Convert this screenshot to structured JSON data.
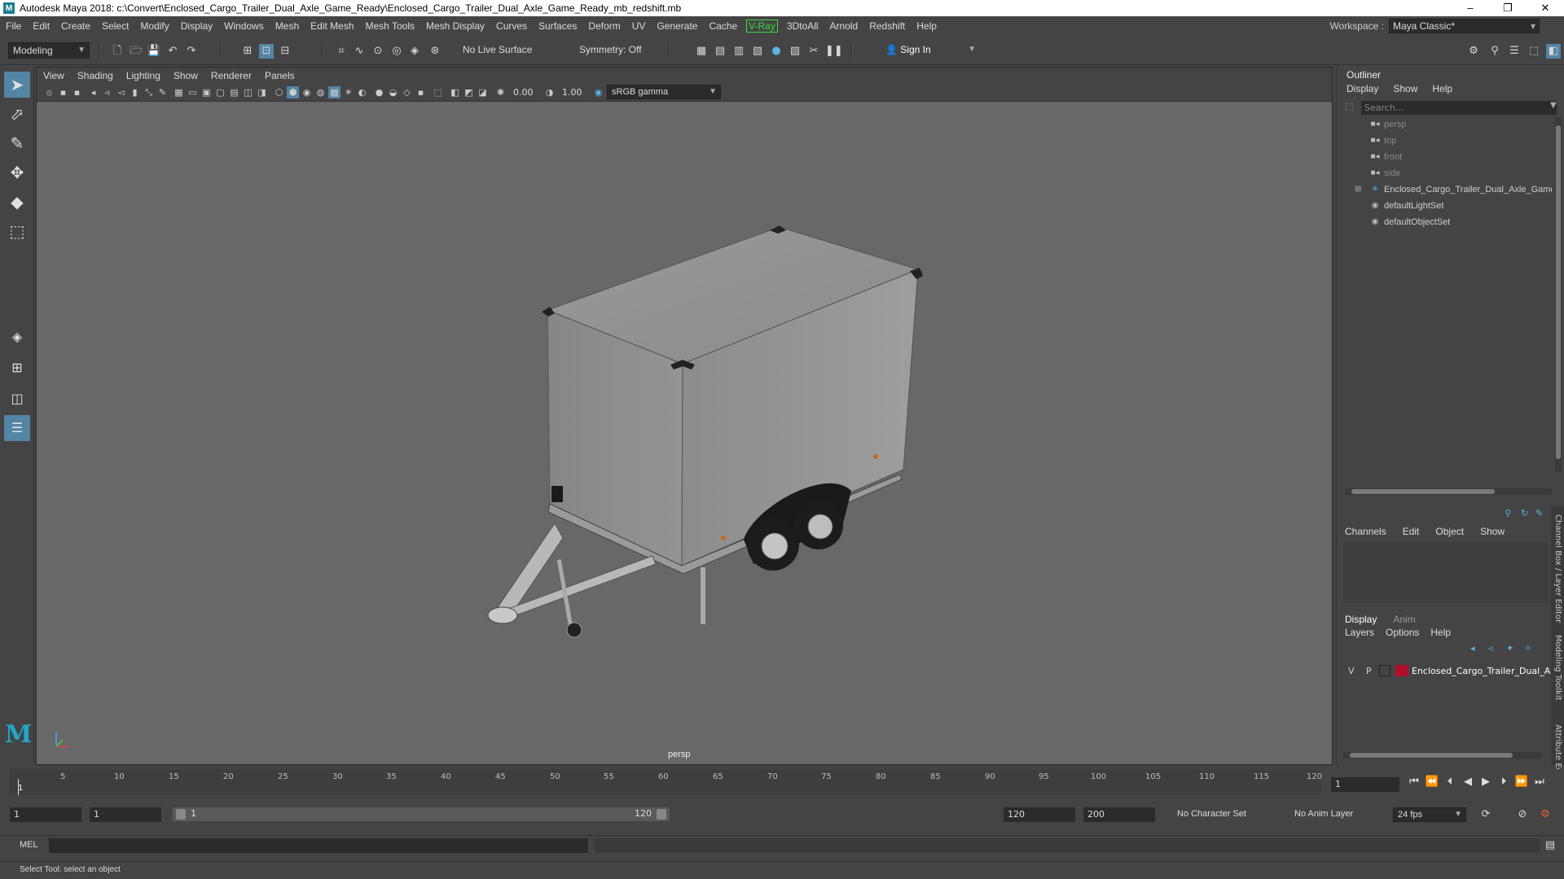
{
  "titlebar": {
    "title": "Autodesk Maya 2018: c:\\Convert\\Enclosed_Cargo_Trailer_Dual_Axle_Game_Ready\\Enclosed_Cargo_Trailer_Dual_Axle_Game_Ready_mb_redshift.mb",
    "logo": "M",
    "minimize": "–",
    "maximize": "❐",
    "close": "✕"
  },
  "menubar": {
    "items": [
      "File",
      "Edit",
      "Create",
      "Select",
      "Modify",
      "Display",
      "Windows",
      "Mesh",
      "Edit Mesh",
      "Mesh Tools",
      "Mesh Display",
      "Curves",
      "Surfaces",
      "Deform",
      "UV",
      "Generate",
      "Cache",
      "V-Ray",
      "3DtoAll",
      "Arnold",
      "Redshift",
      "Help"
    ],
    "workspace_label": "Workspace :",
    "workspace_value": "Maya Classic*"
  },
  "statusline": {
    "mode": "Modeling",
    "live_surface": "No Live Surface",
    "symmetry": "Symmetry: Off",
    "sign_in": "Sign In"
  },
  "toolbox": {
    "tools": [
      "select-tool",
      "lasso-tool",
      "paint-select-tool",
      "move-tool",
      "rotate-tool",
      "scale-tool"
    ]
  },
  "viewport": {
    "menu": [
      "View",
      "Shading",
      "Lighting",
      "Show",
      "Renderer",
      "Panels"
    ],
    "exposure": "0.00",
    "gamma": "1.00",
    "color_space": "sRGB gamma",
    "camera_label": "persp"
  },
  "outliner": {
    "title": "Outliner",
    "menu": [
      "Display",
      "Show",
      "Help"
    ],
    "search_placeholder": "Search...",
    "items": [
      {
        "label": "persp",
        "icon": "camera-icon",
        "dim": true
      },
      {
        "label": "top",
        "icon": "camera-icon",
        "dim": true
      },
      {
        "label": "front",
        "icon": "camera-icon",
        "dim": true
      },
      {
        "label": "side",
        "icon": "camera-icon",
        "dim": true
      },
      {
        "label": "Enclosed_Cargo_Trailer_Dual_Axle_Game",
        "icon": "group-icon",
        "dim": false
      },
      {
        "label": "defaultLightSet",
        "icon": "set-icon",
        "dim": false
      },
      {
        "label": "defaultObjectSet",
        "icon": "set-icon",
        "dim": false
      }
    ]
  },
  "channelbox": {
    "tabs": [
      "Channels",
      "Edit",
      "Object",
      "Show"
    ],
    "layer_tabs": [
      "Display",
      "Anim"
    ],
    "layer_menu": [
      "Layers",
      "Options",
      "Help"
    ],
    "layer": {
      "v": "V",
      "p": "P",
      "name": "Enclosed_Cargo_Trailer_Dual_A",
      "color": "#b0102a"
    },
    "side_tabs": [
      "Channel Box / Layer Editor",
      "Modeling Toolkit",
      "Attribute Editor"
    ]
  },
  "timeslider": {
    "ticks": [
      "5",
      "10",
      "15",
      "20",
      "25",
      "30",
      "35",
      "40",
      "45",
      "50",
      "55",
      "60",
      "65",
      "70",
      "75",
      "80",
      "85",
      "90",
      "95",
      "100",
      "105",
      "110",
      "115",
      "120"
    ],
    "current_frame_marker": "1",
    "current_frame": "1"
  },
  "rangeslider": {
    "start": "1",
    "playback_start": "1",
    "range_start_label": "1",
    "range_end_label": "120",
    "playback_end": "120",
    "end": "200",
    "character_set": "No Character Set",
    "anim_layer": "No Anim Layer",
    "fps": "24 fps"
  },
  "cmdline": {
    "label": "MEL"
  },
  "helpline": {
    "text": "Select Tool: select an object"
  },
  "colors": {
    "accent": "#5285a6",
    "vray": "#3ddc3d",
    "layer": "#b0102a"
  }
}
